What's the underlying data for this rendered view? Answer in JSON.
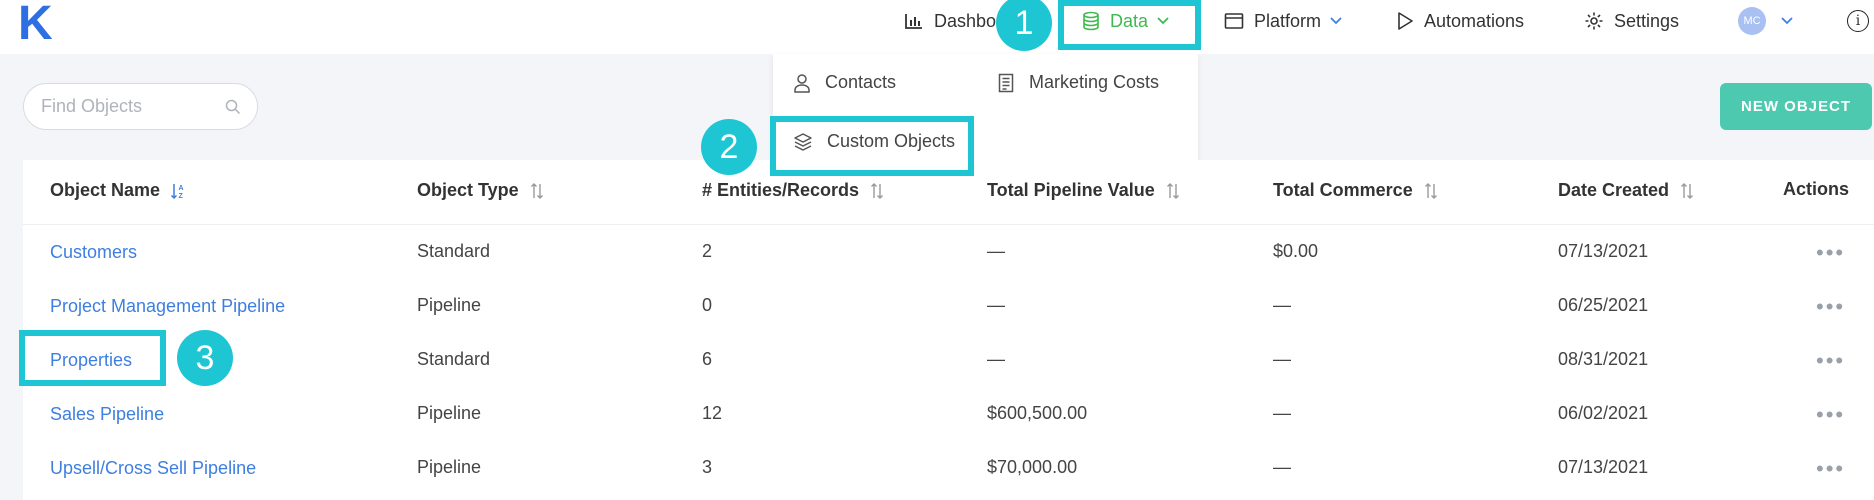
{
  "logo": "K",
  "nav": {
    "dashboard": "Dashbo",
    "data": "Data",
    "platform": "Platform",
    "automations": "Automations",
    "settings": "Settings",
    "avatar_initials": "MC",
    "info": "i"
  },
  "dropdown": {
    "contacts": "Contacts",
    "marketing_costs": "Marketing Costs",
    "custom_objects": "Custom Objects"
  },
  "badges": [
    "1",
    "2",
    "3"
  ],
  "search": {
    "placeholder": "Find Objects"
  },
  "new_object_label": "NEW OBJECT",
  "table": {
    "headers": [
      "Object Name",
      "Object Type",
      "# Entities/Records",
      "Total Pipeline Value",
      "Total Commerce",
      "Date Created",
      "Actions"
    ],
    "rows": [
      [
        "Customers",
        "Standard",
        "2",
        "—",
        "$0.00",
        "07/13/2021"
      ],
      [
        "Project Management Pipeline",
        "Pipeline",
        "0",
        "—",
        "—",
        "06/25/2021"
      ],
      [
        "Properties",
        "Standard",
        "6",
        "—",
        "—",
        "08/31/2021"
      ],
      [
        "Sales Pipeline",
        "Pipeline",
        "12",
        "$600,500.00",
        "—",
        "06/02/2021"
      ],
      [
        "Upsell/Cross Sell Pipeline",
        "Pipeline",
        "3",
        "$70,000.00",
        "—",
        "07/13/2021"
      ]
    ],
    "actions_glyph": "•••"
  },
  "colors": {
    "accent": "#1ec6d4",
    "link": "#3d7fe0",
    "active_nav": "#3dba4e",
    "button": "#4dc9b0"
  }
}
